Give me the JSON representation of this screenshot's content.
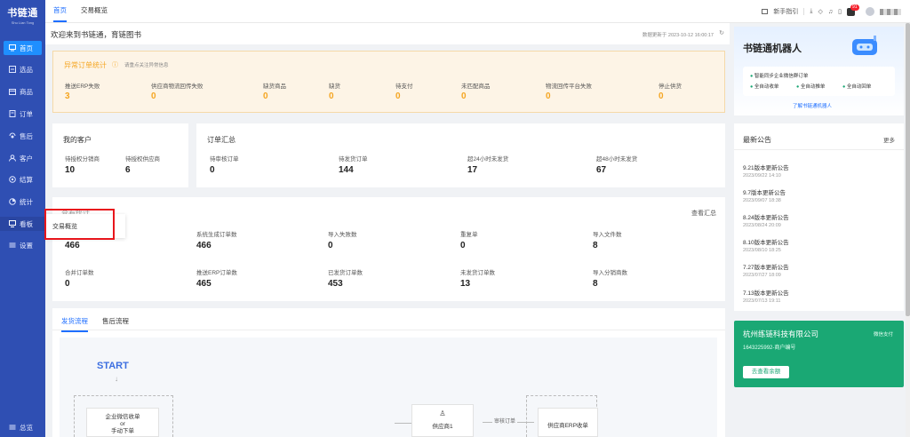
{
  "app": {
    "logo_title": "书链通",
    "logo_sub": "Shu Lian Tong"
  },
  "sidebar": {
    "items": [
      {
        "label": "首页",
        "icon": "monitor-icon"
      },
      {
        "label": "选品",
        "icon": "product-icon"
      },
      {
        "label": "商品",
        "icon": "goods-icon"
      },
      {
        "label": "订单",
        "icon": "order-icon"
      },
      {
        "label": "售后",
        "icon": "aftersale-icon"
      },
      {
        "label": "客户",
        "icon": "customer-icon"
      },
      {
        "label": "结算",
        "icon": "settle-icon"
      },
      {
        "label": "统计",
        "icon": "stats-icon"
      },
      {
        "label": "看板",
        "icon": "board-icon"
      },
      {
        "label": "设置",
        "icon": "settings-icon"
      }
    ],
    "collapse_label": "总览"
  },
  "tabs": [
    "首页",
    "交易概览"
  ],
  "topbar": {
    "guide": "新手指引",
    "badge_count": "91"
  },
  "welcome": {
    "text": "欢迎来到书链通，育链图书",
    "updated": "数据更新于 2023-10-12 16:00:17"
  },
  "abnormal": {
    "title": "异常订单统计",
    "hint": "请重点关注异常信息",
    "items": [
      {
        "label": "推送ERP失败",
        "value": "3"
      },
      {
        "label": "供应商物流回传失败",
        "value": "0"
      },
      {
        "label": "缺货商品",
        "value": "0"
      },
      {
        "label": "缺货",
        "value": "0"
      },
      {
        "label": "待支付",
        "value": "0"
      },
      {
        "label": "未匹配商品",
        "value": "0"
      },
      {
        "label": "物流回传平台失败",
        "value": "0"
      },
      {
        "label": "停止供货",
        "value": "0"
      }
    ]
  },
  "customers": {
    "title": "我的客户",
    "items": [
      {
        "label": "待授权分销商",
        "value": "10"
      },
      {
        "label": "待授权供应商",
        "value": "6"
      }
    ]
  },
  "order_summary": {
    "title": "订单汇总",
    "items": [
      {
        "label": "待审核订单",
        "value": "0"
      },
      {
        "label": "待发货订单",
        "value": "144"
      },
      {
        "label": "超24小时未发货",
        "value": "17"
      },
      {
        "label": "超48小时未发货",
        "value": "67"
      }
    ]
  },
  "stats": {
    "view_summary": "查看汇总",
    "title_partial": "查看统计",
    "items": [
      {
        "label": "",
        "value": "466"
      },
      {
        "label": "系统生成订单数",
        "value": "466"
      },
      {
        "label": "导入失败数",
        "value": "0"
      },
      {
        "label": "重复单",
        "value": "0"
      },
      {
        "label": "导入文件数",
        "value": "8"
      },
      {
        "label": "合并订单数",
        "value": "0"
      },
      {
        "label": "推送ERP订单数",
        "value": "465"
      },
      {
        "label": "已发货订单数",
        "value": "453"
      },
      {
        "label": "未发货订单数",
        "value": "13"
      },
      {
        "label": "导入分销商数",
        "value": "8"
      }
    ]
  },
  "popup": {
    "item": "交易概览"
  },
  "flow": {
    "tabs": [
      "发货流程",
      "售后流程"
    ],
    "start": "START",
    "node1_line1": "企业微信收单",
    "node1_line2": "or",
    "node1_line3": "手动下单",
    "supplier": "供应商1",
    "arrow": "审核订单",
    "erp": "供应商ERP收单"
  },
  "robot": {
    "title": "书链通机器人",
    "bullet1": "智能同步企业微信群订单",
    "bullet2": "全自动收单",
    "bullet3": "全自动推单",
    "bullet4": "全自动回单",
    "link": "了解书链通机器人"
  },
  "notices": {
    "title": "最新公告",
    "more": "更多",
    "items": [
      {
        "title": "9.21版本更新公告",
        "date": "2023/09/22 14:10"
      },
      {
        "title": "9.7版本更新公告",
        "date": "2023/09/07 18:38"
      },
      {
        "title": "8.24版本更新公告",
        "date": "2023/08/24 20:09"
      },
      {
        "title": "8.10版本更新公告",
        "date": "2023/08/10 18:25"
      },
      {
        "title": "7.27版本更新公告",
        "date": "2023/07/27 18:09"
      },
      {
        "title": "7.13版本更新公告",
        "date": "2023/07/13 19:11"
      }
    ]
  },
  "company": {
    "name": "杭州练链科技有限公司",
    "pay": "微信支付",
    "id": "1643225992-商户编号",
    "button": "去查看余额"
  },
  "colors": {
    "sidebar": "#2f4fb3",
    "accent": "#1f6fff",
    "warn": "#f5a623",
    "green": "#18a673"
  }
}
